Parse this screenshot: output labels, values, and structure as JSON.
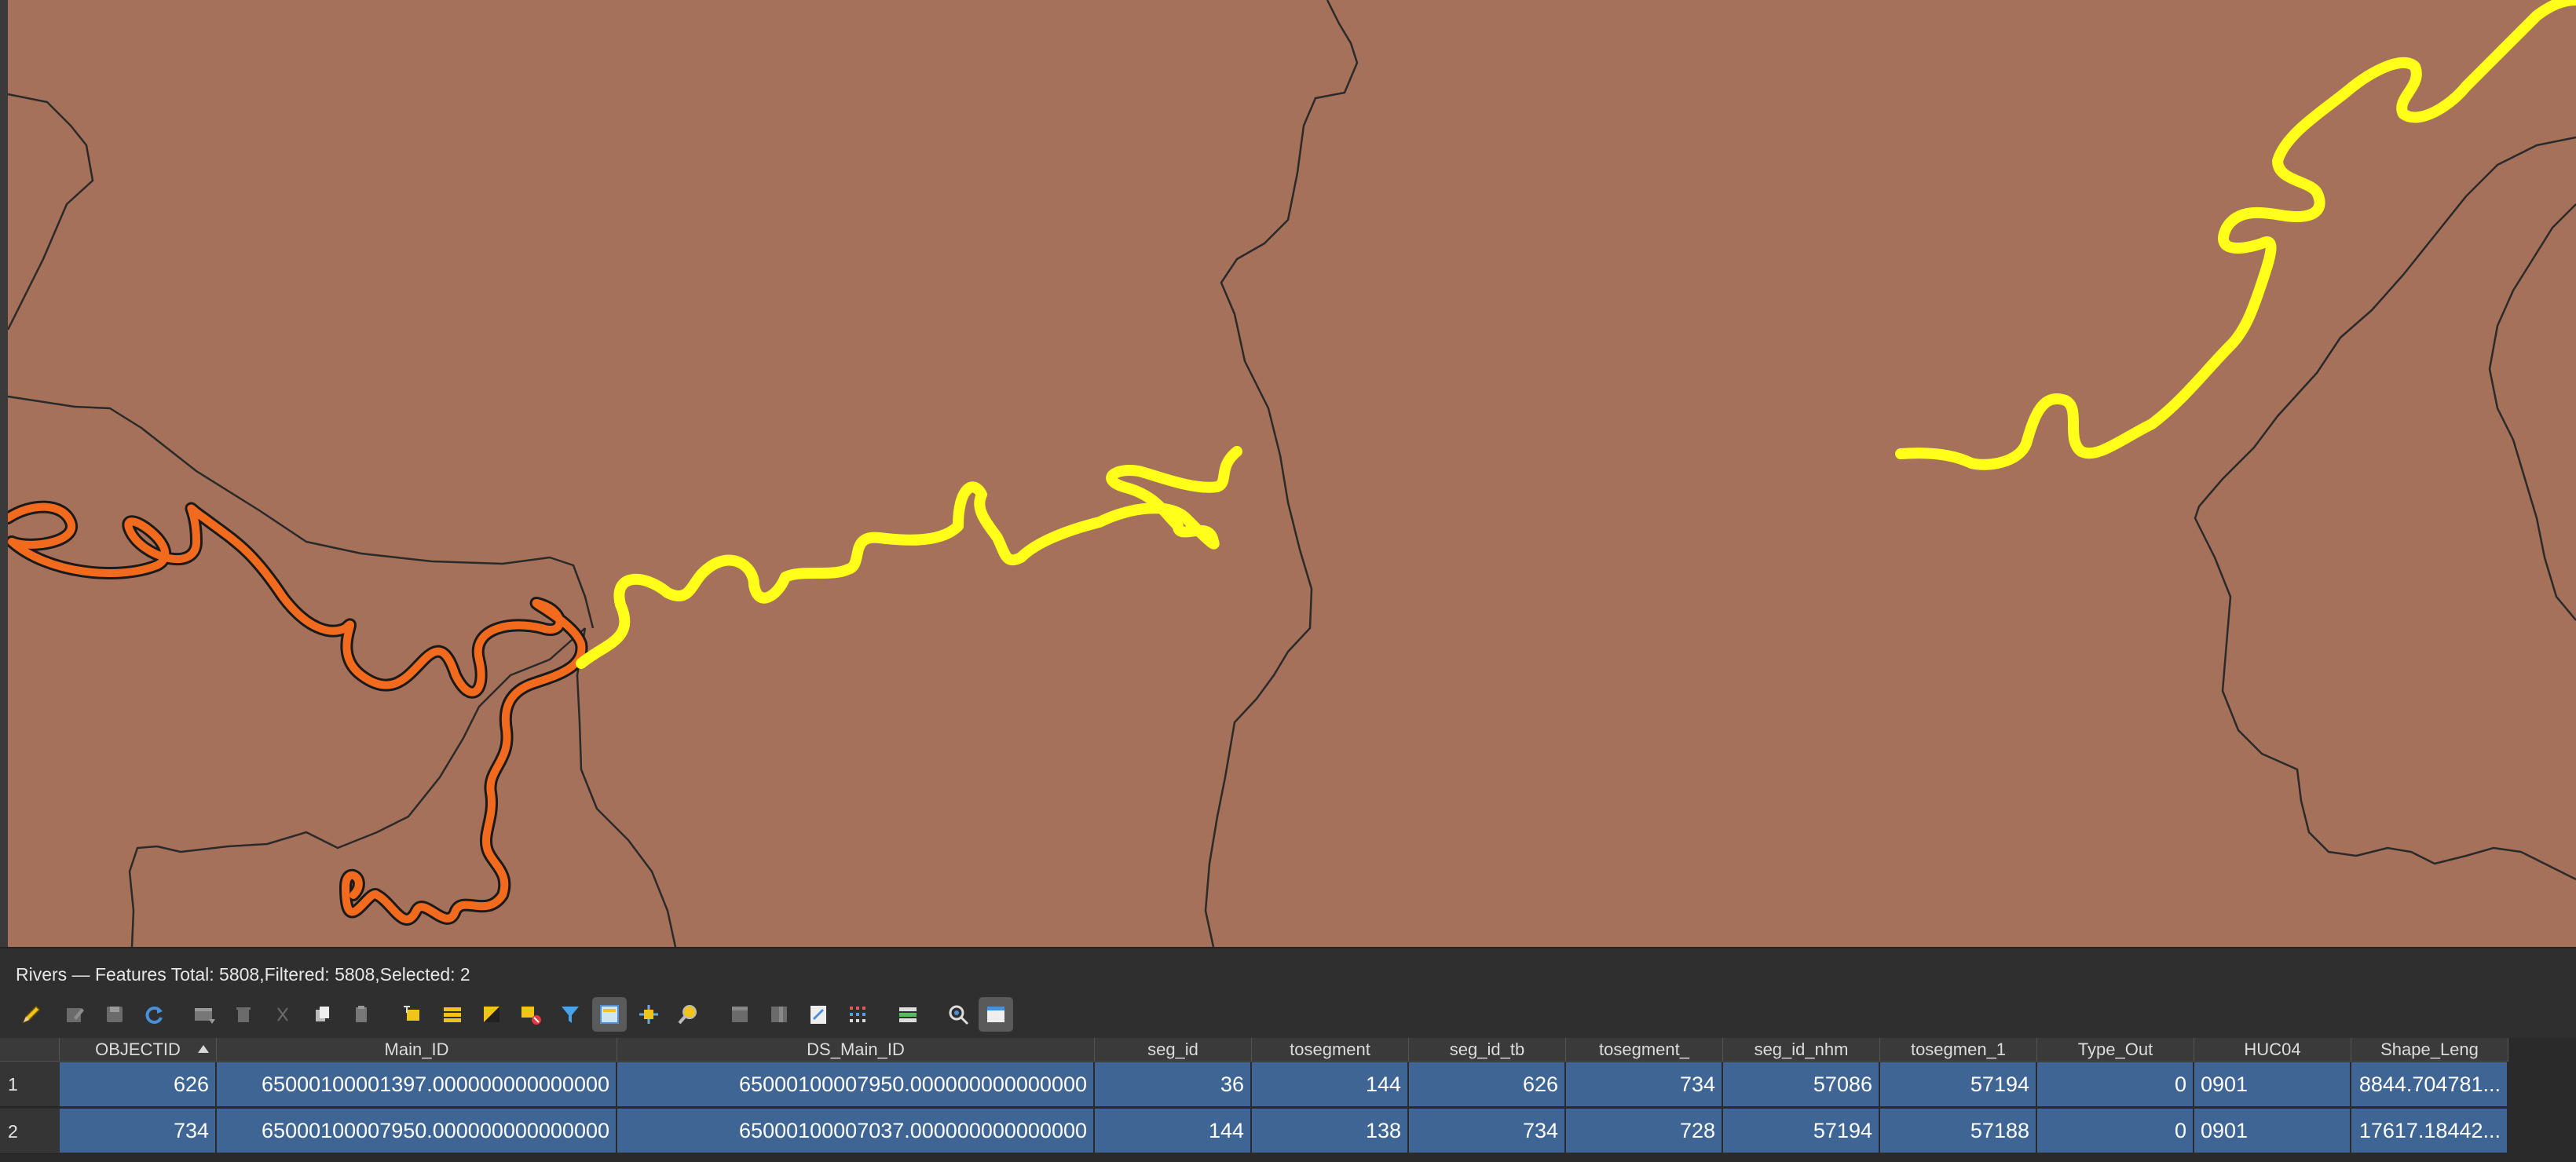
{
  "panel": {
    "title": "Rivers — Features Total: 5808,Filtered: 5808,Selected: 2"
  },
  "colors": {
    "map_background": "#a5715a",
    "selected_river": "#ffff1a",
    "river": "#f26a1d",
    "boundary": "#2a2a2a",
    "selected_row": "#3e6594"
  },
  "toolbar": {
    "icons": [
      "pencil-icon",
      "multi-edit-icon",
      "save-edits-icon",
      "reload-icon",
      "add-feature-icon",
      "delete-feature-icon",
      "cut-icon",
      "copy-icon",
      "paste-icon",
      "select-by-expression-icon",
      "select-all-icon",
      "invert-selection-icon",
      "deselect-icon",
      "filter-icon",
      "move-selection-to-top-icon",
      "pan-to-selection-icon",
      "zoom-to-selection-icon",
      "new-field-icon",
      "delete-field-icon",
      "field-calculator-icon",
      "conditional-formatting-icon",
      "dock-table-icon",
      "actions-icon",
      "switch-view-icon"
    ]
  },
  "table": {
    "columns": [
      "OBJECTID",
      "Main_ID",
      "DS_Main_ID",
      "seg_id",
      "tosegment",
      "seg_id_tb",
      "tosegment_",
      "seg_id_nhm",
      "tosegmen_1",
      "Type_Out",
      "HUC04",
      "Shape_Leng"
    ],
    "rows": [
      {
        "num": "1",
        "cells": [
          "626",
          "65000100001397.000000000000000",
          "65000100007950.000000000000000",
          "36",
          "144",
          "626",
          "734",
          "57086",
          "57194",
          "0",
          "0901",
          "8844.704781..."
        ]
      },
      {
        "num": "2",
        "cells": [
          "734",
          "65000100007950.000000000000000",
          "65000100007037.000000000000000",
          "144",
          "138",
          "734",
          "728",
          "57194",
          "57188",
          "0",
          "0901",
          "17617.18442..."
        ]
      }
    ]
  }
}
